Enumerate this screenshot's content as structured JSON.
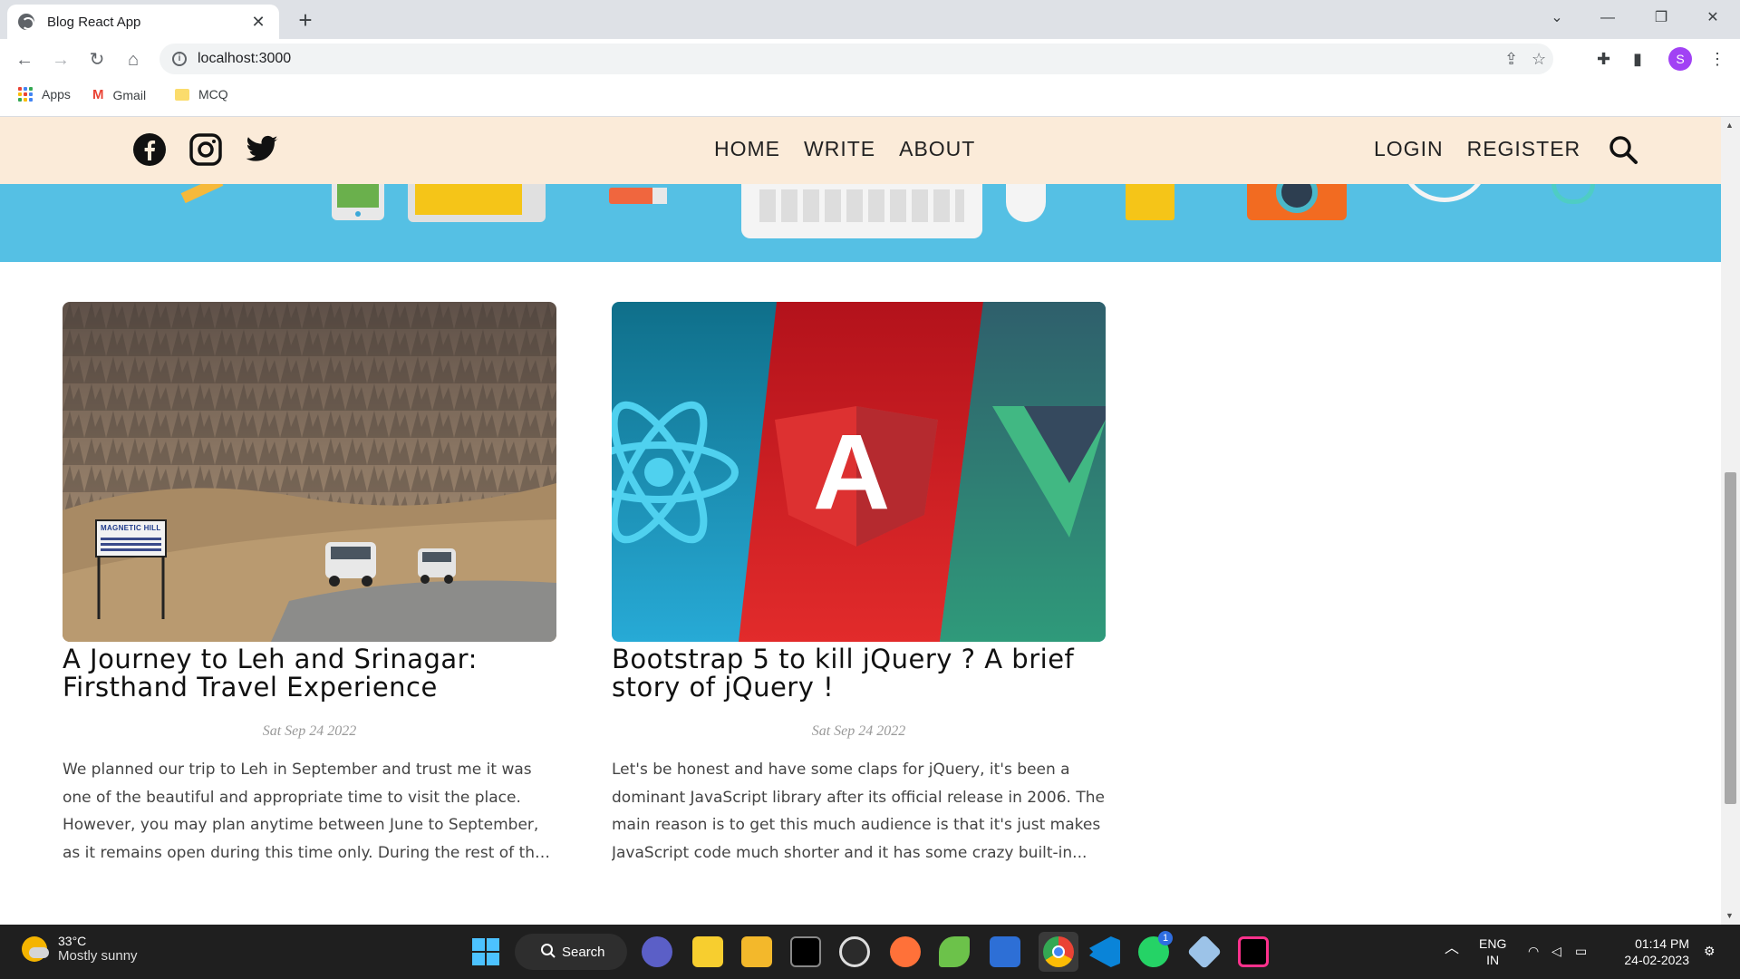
{
  "browser": {
    "tab_title": "Blog React App",
    "url": "localhost:3000",
    "profile_initial": "S",
    "bookmarks": [
      {
        "label": "Apps",
        "icon": "apps-grid-icon"
      },
      {
        "label": "Gmail",
        "icon": "gmail-icon"
      },
      {
        "label": "MCQ",
        "icon": "folder-icon"
      }
    ]
  },
  "site": {
    "menu": [
      "HOME",
      "WRITE",
      "ABOUT"
    ],
    "auth": [
      "LOGIN",
      "REGISTER"
    ],
    "social_icons": [
      "facebook-icon",
      "instagram-icon",
      "twitter-icon"
    ]
  },
  "posts": [
    {
      "title": "A Journey to Leh and Srinagar: Firsthand Travel Experience",
      "date": "Sat Sep 24 2022",
      "desc": "We planned our trip to Leh in September and trust me it was one of the beautiful and appropriate time to visit the place. However, you may plan anytime between June to September, as it remains open during this time only. During the rest of the year, it usually...",
      "sign_text": "MAGNETIC HILL"
    },
    {
      "title": "Bootstrap 5 to kill jQuery ? A brief story of jQuery !",
      "date": "Sat Sep 24 2022",
      "desc": "Let's be honest and have some claps for jQuery, it's been a dominant JavaScript library after its official release in 2006. The main reason is to get this much audience is that it's just makes JavaScript code much shorter and it has some crazy built-in...",
      "image_letter": "A"
    }
  ],
  "taskbar": {
    "temperature": "33°C",
    "weather": "Mostly sunny",
    "search_label": "Search",
    "lang1": "ENG",
    "lang2": "IN",
    "time": "01:14 PM",
    "date": "24-02-2023",
    "whatsapp_badge": "1"
  }
}
